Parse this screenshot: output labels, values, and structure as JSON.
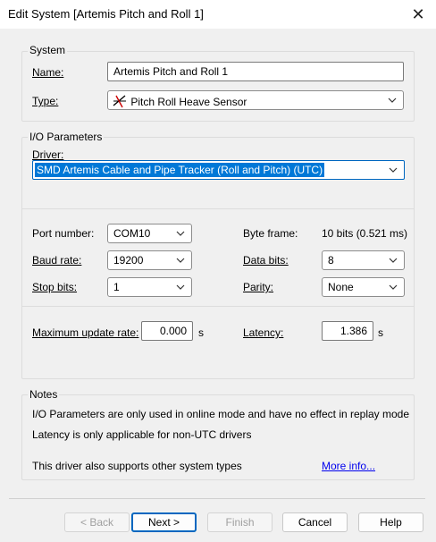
{
  "window": {
    "title": "Edit System [Artemis Pitch and Roll 1]"
  },
  "system": {
    "group_title": "System",
    "name_label": "Name:",
    "name_value": "Artemis Pitch and Roll 1",
    "type_label": "Type:",
    "type_value": "Pitch Roll Heave Sensor"
  },
  "io": {
    "group_title": "I/O Parameters",
    "driver_label": "Driver:",
    "driver_value": "SMD Artemis Cable and Pipe Tracker (Roll and Pitch) (UTC)",
    "port_label": "Port number:",
    "port_value": "COM10",
    "byte_frame_label": "Byte frame:",
    "byte_frame_value": "10 bits (0.521 ms)",
    "baud_label": "Baud rate:",
    "baud_value": "19200",
    "data_bits_label": "Data bits:",
    "data_bits_value": "8",
    "stop_label": "Stop bits:",
    "stop_value": "1",
    "parity_label": "Parity:",
    "parity_value": "None",
    "max_rate_label": "Maximum update rate:",
    "max_rate_value": "0.000",
    "max_rate_unit": "s",
    "latency_label": "Latency:",
    "latency_value": "1.386",
    "latency_unit": "s"
  },
  "notes": {
    "group_title": "Notes",
    "line1": "I/O Parameters are only used in online mode and have no effect in replay mode",
    "line2": "Latency is only applicable for non-UTC drivers",
    "line3": "This driver also supports other system types",
    "more_info": "More info..."
  },
  "buttons": {
    "back": "< Back",
    "next": "Next >",
    "finish": "Finish",
    "cancel": "Cancel",
    "help": "Help"
  },
  "colors": {
    "accent": "#0067c0",
    "selection": "#0078d7",
    "link": "#0000ee"
  }
}
